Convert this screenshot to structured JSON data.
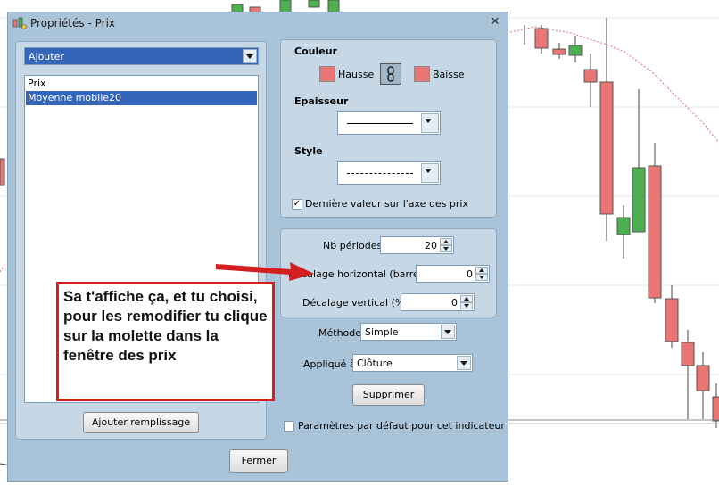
{
  "dialog": {
    "title": "Propriétés - Prix",
    "close_glyph": "✕"
  },
  "left": {
    "add_combo": "Ajouter",
    "list_items": [
      "Prix",
      "Moyenne mobile20"
    ],
    "fill_button": "Ajouter remplissage"
  },
  "style_panel": {
    "couleur_label": "Couleur",
    "hausse_label": "Hausse",
    "baisse_label": "Baisse",
    "epaisseur_label": "Epaisseur",
    "style_label": "Style",
    "last_value_label": "Dernière valeur sur l'axe des prix",
    "last_value_checked": true,
    "color_hausse": "#e97575",
    "color_baisse": "#e97575"
  },
  "params_panel": {
    "periods_label": "Nb périodes",
    "periods_value": "20",
    "hshift_label": "Décalage horizontal (barres)",
    "hshift_value": "0",
    "vshift_label": "Décalage vertical (%)",
    "vshift_value": "0"
  },
  "method": {
    "label": "Méthode",
    "value": "Simple"
  },
  "applied": {
    "label": "Appliqué à",
    "value": "Clôture"
  },
  "delete_button": "Supprimer",
  "default_params_label": "Paramètres par défaut pour cet indicateur",
  "close_button": "Fermer",
  "annotation": {
    "text": "Sa t'affiche ça, et tu choisi, pour les remodifier tu clique sur la molette dans la fenêtre des prix"
  },
  "colors": {
    "up_candle": "#4caf50",
    "down_candle": "#e97575",
    "annotation_border": "#d21e1e"
  }
}
